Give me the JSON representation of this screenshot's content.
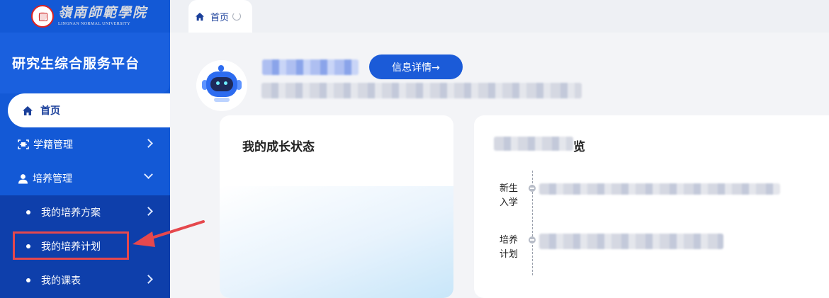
{
  "sidebar": {
    "logo": {
      "name_cn": "嶺南師範學院",
      "name_en": "LINGNAN NORMAL UNIVERSITY"
    },
    "platform_title": "研究生综合服务平台",
    "home_label": "首页",
    "items": [
      {
        "label": "学籍管理",
        "icon": "id-scan-icon",
        "state": "collapsed"
      },
      {
        "label": "培养管理",
        "icon": "user-icon",
        "state": "expanded"
      }
    ],
    "sub_items": [
      {
        "label": "我的培养方案",
        "has_chevron": true
      },
      {
        "label": "我的培养计划",
        "has_chevron": false,
        "highlighted": true
      },
      {
        "label": "我的课表",
        "has_chevron": true
      }
    ]
  },
  "tabs": [
    {
      "label": "首页",
      "icon": "home-icon",
      "active": true
    }
  ],
  "profile": {
    "detail_button_label": "信息详情→"
  },
  "cards": {
    "growth": {
      "title": "我的成长状态"
    },
    "timeline": {
      "title_visible_suffix": "览",
      "stages": [
        {
          "label": "新生入学"
        },
        {
          "label": "培养计划"
        }
      ]
    }
  },
  "colors": {
    "sidebar": "#1359d6",
    "sub_panel": "#0e3fab",
    "accent": "#1b5bd8",
    "annotation": "#e5484d"
  }
}
